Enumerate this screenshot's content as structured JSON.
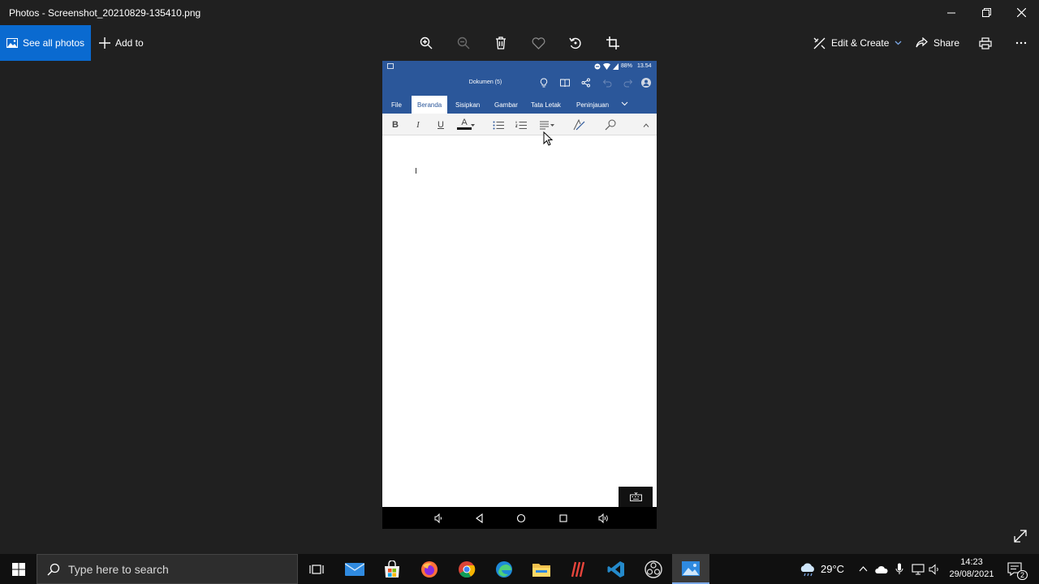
{
  "window": {
    "title": "Photos - Screenshot_20210829-135410.png",
    "minimize_icon": "minimize-icon",
    "maximize_icon": "restore-icon",
    "close_icon": "close-icon"
  },
  "toolbar": {
    "see_all_photos": "See all photos",
    "add_to": "Add to",
    "edit_create": "Edit & Create",
    "share": "Share",
    "tools": [
      "zoom-in-icon",
      "zoom-out-icon",
      "delete-icon",
      "favorite-icon",
      "rotate-icon",
      "crop-icon"
    ]
  },
  "phone": {
    "status": {
      "battery": "88%",
      "time": "13.54"
    },
    "document_title": "Dokumen (5)",
    "ribbon_tabs": [
      "File",
      "Beranda",
      "Sisipkan",
      "Gambar",
      "Tata Letak",
      "Peninjauan"
    ],
    "active_tab": "Beranda",
    "format": {
      "bold": "B",
      "italic": "I",
      "underline": "U",
      "font_color": "A",
      "font_color_hex": "#c00000"
    },
    "accent": "#2b579a"
  },
  "taskbar": {
    "search_placeholder": "Type here to search",
    "apps": [
      "task-view-icon",
      "mail-icon",
      "store-icon",
      "firefox-icon",
      "chrome-icon",
      "edge-icon",
      "file-explorer-icon",
      "app-icon",
      "vscode-icon",
      "obs-icon",
      "photos-icon"
    ],
    "weather": "29°C",
    "time": "14:23",
    "date": "29/08/2021",
    "notifications": "2"
  }
}
